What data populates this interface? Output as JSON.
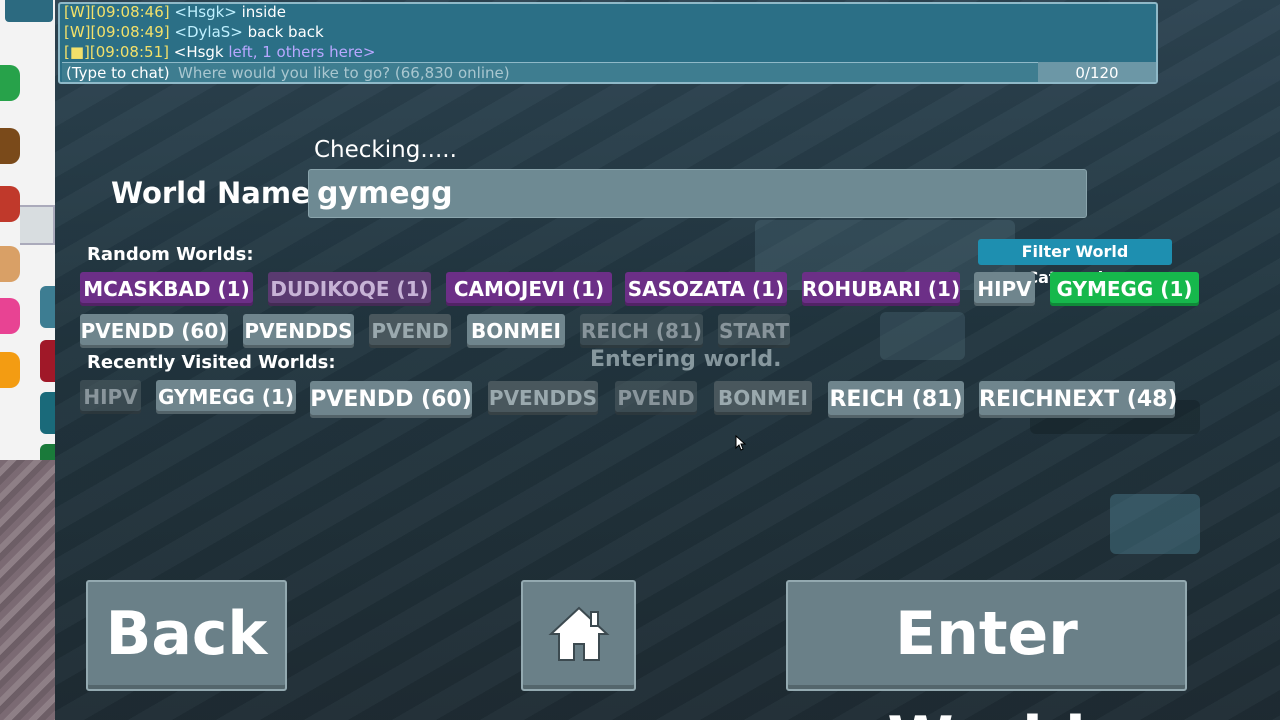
{
  "chat": {
    "lines": [
      {
        "tag": "[W]",
        "time": "[09:08:46]",
        "name": "<Hsgk>",
        "text": " inside"
      },
      {
        "tag": "[W]",
        "time": "[09:08:49]",
        "name": "<DylaS>",
        "text": " back back"
      },
      {
        "tag": "[■]",
        "time": "[09:08:51]",
        "name": "<Hsgk",
        "text": " left, 1 others here>"
      }
    ],
    "input_placeholder": "(Type to chat)",
    "ghost_text": "Where would you like to go? (66,830 online)",
    "counter": "0/120"
  },
  "status": {
    "checking": "Checking.....",
    "entering": "Entering world."
  },
  "world_name": {
    "label": "World Name:",
    "value": "gymegg"
  },
  "random_worlds": {
    "label": "Random Worlds:",
    "filter_label": "Filter World Categories",
    "row1": [
      "MCASKBAD (1)",
      "DUDIKOQE (1)",
      "CAMOJEVI (1)",
      "SASOZATA (1)",
      "ROHUBARI (1)",
      "HIPV",
      "GYMEGG (1)"
    ],
    "row2": [
      "PVENDD (60)",
      "PVENDDS",
      "PVEND",
      "BONMEI",
      "REICH (81)",
      "START"
    ]
  },
  "recent_worlds": {
    "label": "Recently Visited Worlds:",
    "items": [
      "HIPV",
      "GYMEGG (1)",
      "PVENDD (60)",
      "PVENDDS",
      "PVEND",
      "BONMEI",
      "REICH (81)",
      "REICHNEXT (48)"
    ]
  },
  "buttons": {
    "back": "Back",
    "home_icon": "home-icon",
    "enter": "Enter World"
  },
  "colors": {
    "chat_bg": "#2b6f86",
    "chip_purple": "#6c2f87",
    "chip_gray": "#6f858d",
    "chip_green": "#16b84c",
    "filter_blue": "#1e8fb0"
  }
}
